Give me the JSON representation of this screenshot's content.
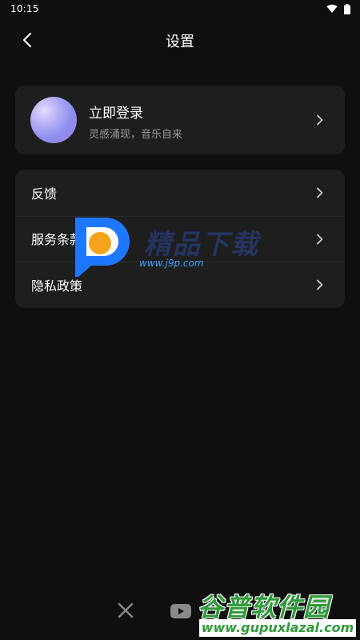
{
  "status_bar": {
    "time": "10:15"
  },
  "header": {
    "title": "设置",
    "back_icon": "chevron-left-icon"
  },
  "login": {
    "title": "立即登录",
    "subtitle": "灵感涌现，音乐自来",
    "avatar": "avatar-gradient",
    "chevron_icon": "chevron-right-icon"
  },
  "menu": {
    "items": [
      {
        "label": "反馈"
      },
      {
        "label": "服务条款"
      },
      {
        "label": "隐私政策"
      }
    ]
  },
  "social": {
    "icons": [
      "x-icon",
      "youtube-icon"
    ]
  },
  "watermark": {
    "text": "精品下载",
    "url": "www.j9p.com"
  },
  "banner": {
    "name": "谷普软件园",
    "url": "www.gupuxlazal.com"
  },
  "colors": {
    "background": "#0f0f0f",
    "card": "#1e1e1e",
    "text": "#ffffff",
    "subtext": "#9a9a9a"
  }
}
